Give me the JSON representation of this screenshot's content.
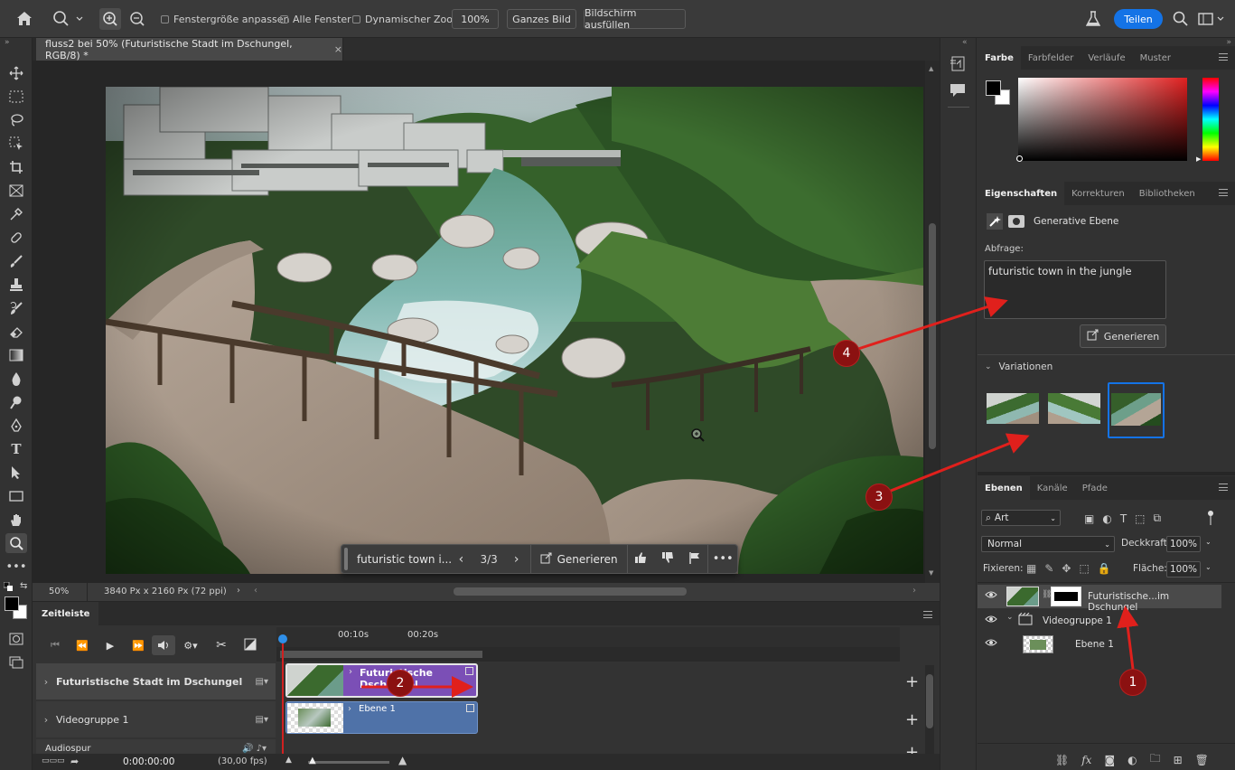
{
  "options_bar": {
    "zoom_percent": "100%",
    "checkbox_resize_windows": "Fenstergröße anpassen",
    "checkbox_all_windows": "Alle Fenster",
    "checkbox_scrubby_zoom": "Dynamischer Zoom",
    "fit_screen_label": "Ganzes Bild",
    "fill_screen_label": "Bildschirm ausfüllen",
    "share_label": "Teilen"
  },
  "document": {
    "tab_title": "fluss2 bei 50% (Futuristische Stadt im Dschungel, RGB/8) *",
    "status_zoom": "50%",
    "status_info": "3840 Px x 2160 Px (72 ppi)"
  },
  "contextual_bar": {
    "prompt_text": "futuristic town i...",
    "counter": "3/3",
    "generate_label": "Generieren"
  },
  "timeline": {
    "panel_title": "Zeitleiste",
    "ruler_marks": [
      "00:10s",
      "00:20s"
    ],
    "tracks": [
      {
        "name": "Futuristische Stadt im Dschungel",
        "clip_label": "Futuristische Dschungel"
      },
      {
        "name": "Videogruppe 1",
        "clip_label": "Ebene 1"
      }
    ],
    "audio_track": "Audiospur",
    "timecode": "0:00:00:00",
    "fps": "(30,00 fps)"
  },
  "color_panel": {
    "tabs": [
      "Farbe",
      "Farbfelder",
      "Verläufe",
      "Muster"
    ],
    "active_tab": "Farbe",
    "hue_color": "#e02020"
  },
  "properties_panel": {
    "tabs": [
      "Eigenschaften",
      "Korrekturen",
      "Bibliotheken"
    ],
    "layer_type": "Generative Ebene",
    "prompt_label": "Abfrage:",
    "prompt_value": "futuristic town in the jungle",
    "generate_label": "Generieren",
    "variations_label": "Variationen",
    "selected_variation": 3
  },
  "layers_panel": {
    "tabs": [
      "Ebenen",
      "Kanäle",
      "Pfade"
    ],
    "filter_kind": "Art",
    "blend_mode": "Normal",
    "opacity_label": "Deckkraft:",
    "opacity_value": "100%",
    "lock_label": "Fixieren:",
    "fill_label": "Fläche:",
    "fill_value": "100%",
    "layers": [
      {
        "name": "Futuristische...im Dschungel",
        "selected": true
      },
      {
        "name": "Videogruppe 1",
        "selected": false
      },
      {
        "name": "Ebene 1",
        "selected": false
      }
    ]
  },
  "annotations": {
    "markers": [
      "1",
      "2",
      "3",
      "4"
    ],
    "color": "#e0201c"
  }
}
